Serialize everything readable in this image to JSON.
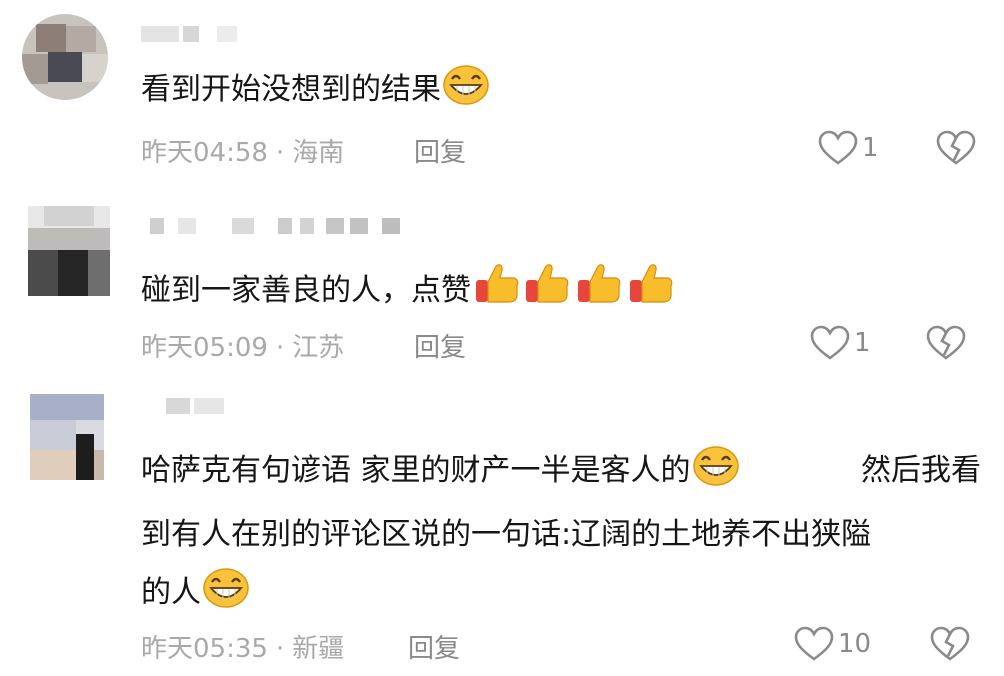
{
  "comments": [
    {
      "text": "看到开始没想到的结果",
      "time": "昨天04:58",
      "location": "海南",
      "reply_label": "回复",
      "likes": "1"
    },
    {
      "text": "碰到一家善良的人，点赞",
      "time": "昨天05:09",
      "location": "江苏",
      "reply_label": "回复",
      "likes": "1"
    },
    {
      "text_lines": [
        "哈萨克有句谚语  家里的财产一半是客人的",
        "到有人在别的评论区说的一句话:辽阔的土地养不出狭隘",
        "的人"
      ],
      "line1_tail": "然后我看",
      "time": "昨天05:35",
      "location": "新疆",
      "reply_label": "回复",
      "likes": "10"
    }
  ],
  "meta_separator": "·",
  "icons": {
    "like": "heart-outline-icon",
    "dislike": "broken-heart-icon",
    "laugh_emoji": "grinning-emoji",
    "thumbs_up_emoji": "thumbs-up-emoji"
  }
}
